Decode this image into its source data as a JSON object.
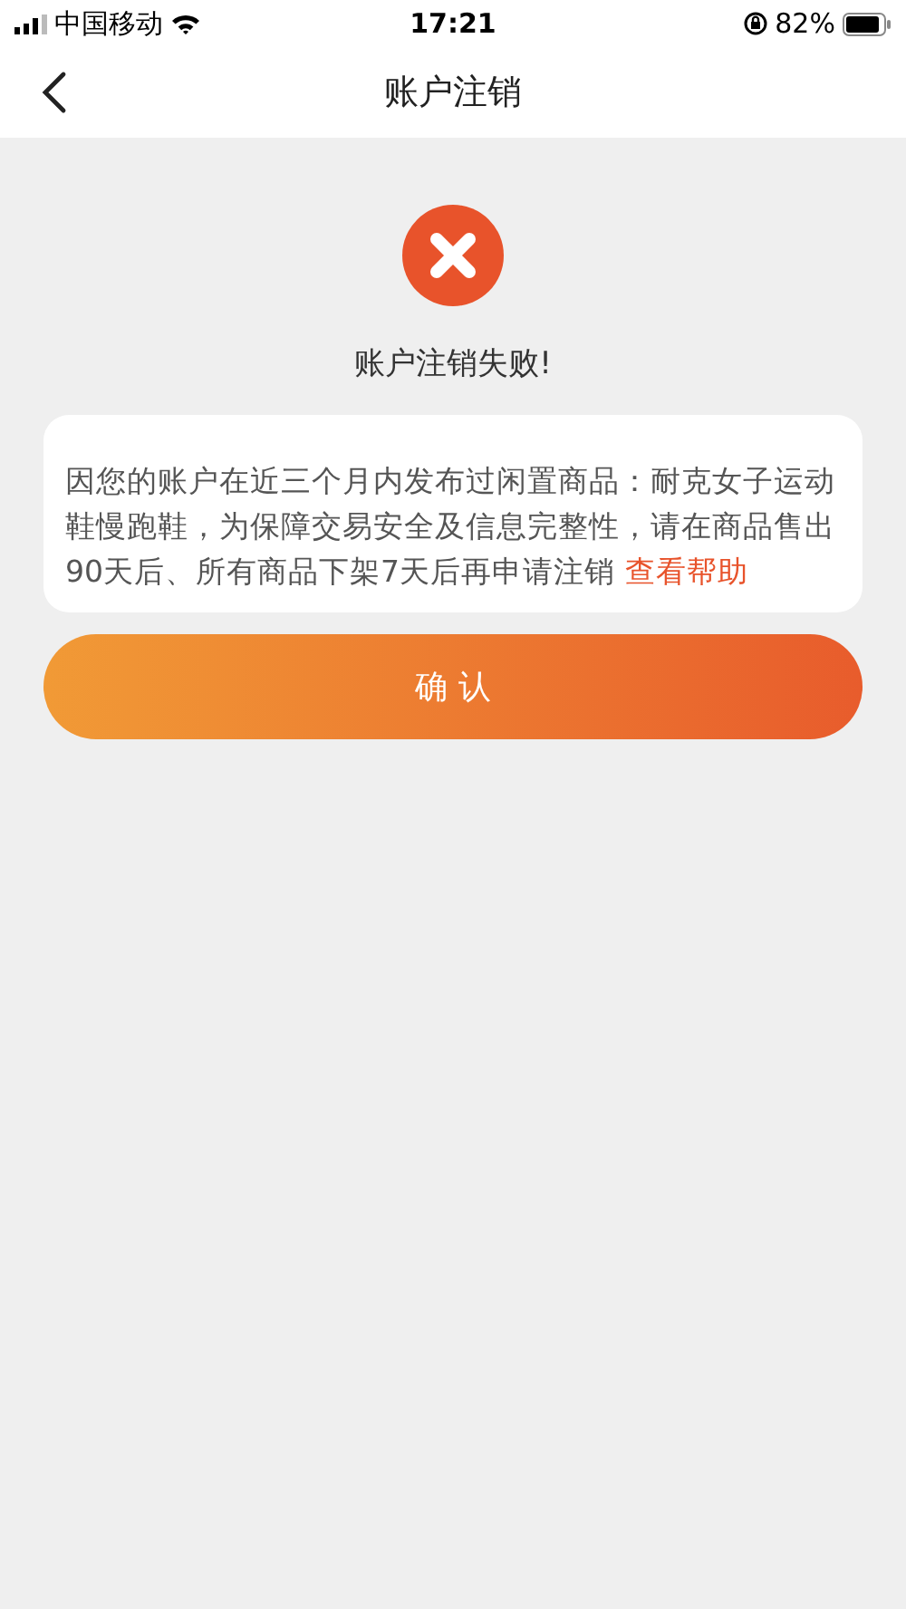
{
  "status_bar": {
    "carrier": "中国移动",
    "time": "17:21",
    "battery": "82%"
  },
  "nav": {
    "title": "账户注销"
  },
  "result": {
    "kind": "error",
    "title": "账户注销失败!"
  },
  "message": {
    "text": "因您的账户在近三个月内发布过闲置商品：耐克女子运动鞋慢跑鞋，为保障交易安全及信息完整性，请在商品售出90天后、所有商品下架7天后再申请注销 ",
    "link": "查看帮助"
  },
  "confirm_button": "确 认"
}
